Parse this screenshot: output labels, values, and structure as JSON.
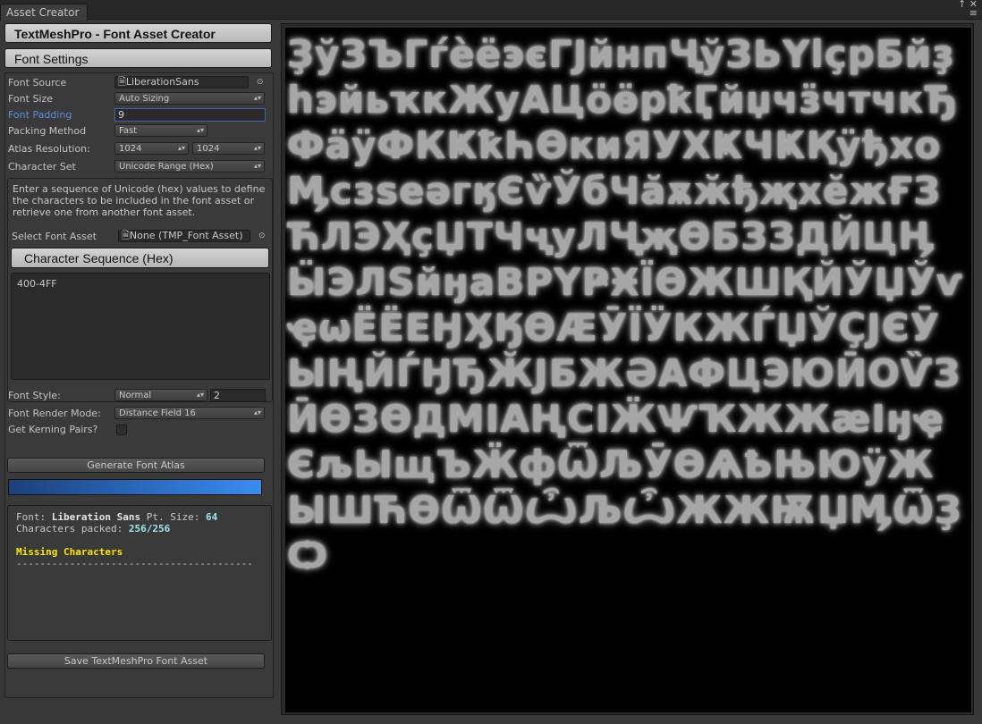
{
  "window": {
    "tab_title": "Asset Creator",
    "controls": "↑ ✕\n≡"
  },
  "header": {
    "title": "TextMeshPro - Font Asset Creator",
    "section": "Font Settings"
  },
  "settings": {
    "font_source_label": "Font Source",
    "font_source_value": "LiberationSans",
    "font_size_label": "Font Size",
    "font_size_value": "Auto Sizing",
    "font_padding_label": "Font Padding",
    "font_padding_value": "9",
    "packing_label": "Packing Method",
    "packing_value": "Fast",
    "atlas_label": "Atlas Resolution:",
    "atlas_w": "1024",
    "atlas_h": "1024",
    "charset_label": "Character Set",
    "charset_value": "Unicode Range (Hex)"
  },
  "charset_box": {
    "help": "Enter a sequence of Unicode (hex) values to define the characters to be included in the font asset or retrieve one from another font asset.",
    "select_label": "Select Font Asset",
    "select_value": "None (TMP_Font Asset)",
    "seq_button": "Character Sequence (Hex)",
    "seq_value": "400-4FF"
  },
  "style": {
    "font_style_label": "Font Style:",
    "font_style_value": "Normal",
    "font_style_num": "2",
    "render_label": "Font Render Mode:",
    "render_value": "Distance Field 16",
    "kerning_label": "Get Kerning Pairs?"
  },
  "actions": {
    "generate": "Generate Font Atlas",
    "save": "Save TextMeshPro Font Asset",
    "progress": 1.0
  },
  "info": {
    "font_label": "Font:",
    "font_name": "Liberation Sans",
    "pt_label": "Pt. Size:",
    "pt_value": "64",
    "packed_label": "Characters packed:",
    "packed_value": "256/256",
    "missing_title": "Missing Characters",
    "missing_rule": "----------------------------------------"
  },
  "atlas": {
    "glyphs": "ҘўЗЪГѓèёэєГЈйнпҶўЗЬҮӏҫрБйҙһэйьҡкЖуАЦöӫрҟӶйџчӟчтчкЂФӓӱФКҜҟҺѲкиЯУХҜЧҜҚӱђхоӍсзѕеәгӄЄѷЎбЧӑѫӂђҗхӗжҒЗЋЛЭҲçЏТЧҷуЛҶҗӨБЗЗДЙЦӉӸЭЛSйӈаВРҮҎӾЇӨЖШҚЙЎЏЎѵҿѡЁЁЕӇӼӃӨӔӮЇӰКЖЃЏЎҪЈЄӮЫҢЙЃӇЂӁЈБЖӘАФЦЭЮӢОѶЗӢӨЗӨДМӀАҢСӀӜѰҠЖЖӕӀӈҿЄљЫщЪӜфѾЉӮӨѦҌЊЮӱЖЫШЋӨѾѾѼЉѼЖЖѬЏӍѾҘѺ"
  }
}
